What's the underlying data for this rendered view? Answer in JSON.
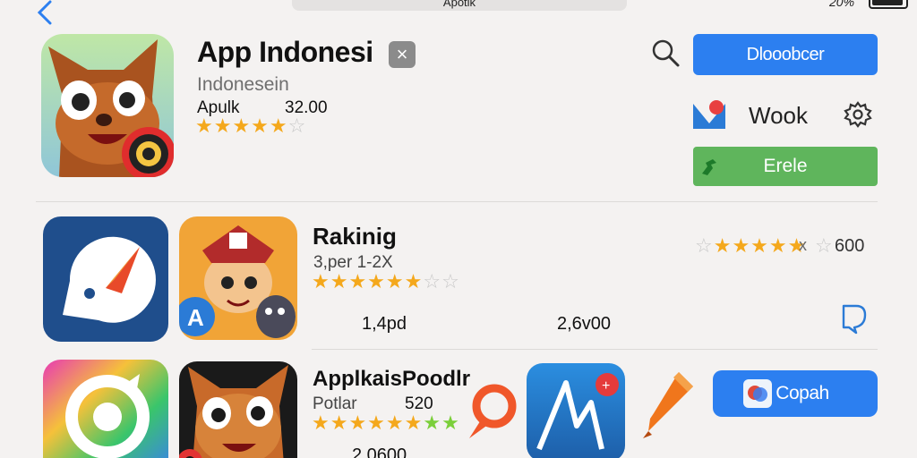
{
  "statusbar": {
    "search_text": "Apotik",
    "battery_text": "20%"
  },
  "featured": {
    "title": "App Indonesi",
    "close_label": "×",
    "subtitle": "Indonesein",
    "author": "Apulk",
    "rating_value": "32.00",
    "stars_on": 5,
    "stars_total": 6,
    "primary_button": "Dlooobcer",
    "secondary_label": "Wook",
    "green_button": "Erele"
  },
  "ranking": {
    "title": "Rakinig",
    "subtitle": "3,per 1-2X",
    "stat_left": "1,4pd",
    "stat_right": "2,6v00",
    "right_rating_value": "600",
    "right_rating_prefix": "x"
  },
  "popular": {
    "title": "ApplkaisPoodlr",
    "subtitle": "Potlar",
    "rating_value": "520",
    "stat_bottom": "2,0600",
    "button_label": "Copah"
  },
  "colors": {
    "accent_blue": "#2c7ff0",
    "accent_green": "#5fb55c",
    "star": "#f4a81c"
  }
}
